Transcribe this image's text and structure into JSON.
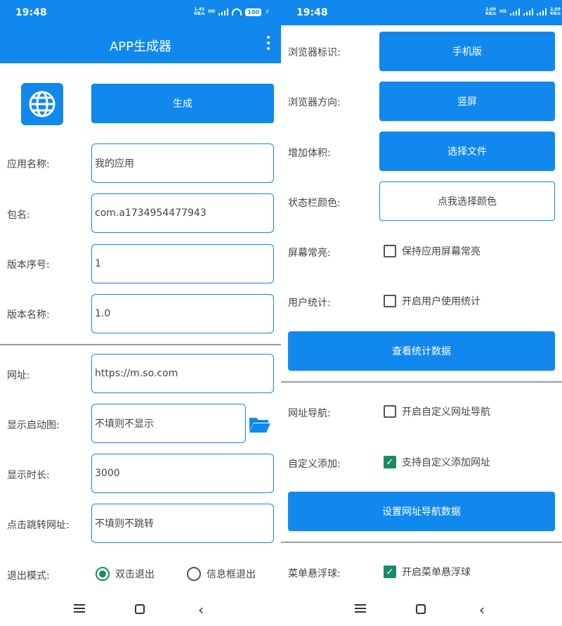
{
  "status": {
    "left_time": "19:48",
    "left_speed_value": "1.45",
    "left_speed_unit": "KB/s",
    "left_hd": "HD",
    "left_battery": "100",
    "right_time": "19:48",
    "right_speed_value": "2.09",
    "right_speed_unit": "KB/s",
    "right_hd": "HD",
    "right_speed2_value": "2.09",
    "right_speed2_unit": "KB/s"
  },
  "appbar": {
    "title": "APP生成器",
    "menu_icon": "more-vertical-icon"
  },
  "generate_button": "生成",
  "fields": {
    "app_name": {
      "label": "应用名称:",
      "value": "我的应用"
    },
    "package": {
      "label": "包名:",
      "value": "com.a1734954477943"
    },
    "version_code": {
      "label": "版本序号:",
      "value": "1"
    },
    "version_name": {
      "label": "版本名称:",
      "value": "1.0"
    },
    "url": {
      "label": "网址:",
      "value": "https://m.so.com"
    },
    "splash": {
      "label": "显示启动图:",
      "value": "不填则不显示"
    },
    "duration": {
      "label": "显示时长:",
      "value": "3000"
    },
    "click_url": {
      "label": "点击跳转网址:",
      "value": "不填则不跳转"
    }
  },
  "exit_mode": {
    "label": "退出模式:",
    "options": [
      {
        "label": "双击退出",
        "selected": true
      },
      {
        "label": "信息框退出",
        "selected": false
      }
    ]
  },
  "right": {
    "ua": {
      "label": "浏览器标识:",
      "value": "手机版"
    },
    "orientation": {
      "label": "浏览器方向:",
      "value": "竖屏"
    },
    "size": {
      "label": "增加体积:",
      "value": "选择文件"
    },
    "statusbar_color": {
      "label": "状态栏颜色:",
      "value": "点我选择颜色"
    },
    "keep_screen": {
      "label": "屏幕常亮:",
      "option": "保持应用屏幕常亮",
      "checked": false
    },
    "stats": {
      "label": "用户统计:",
      "option": "开启用户使用统计",
      "checked": false
    },
    "view_stats_button": "查看统计数据",
    "url_nav": {
      "label": "网址导航:",
      "option": "开启自定义网址导航",
      "checked": false
    },
    "custom_add": {
      "label": "自定义添加:",
      "option": "支持自定义添加网址",
      "checked": true
    },
    "set_nav_button": "设置网址导航数据",
    "float_menu": {
      "label": "菜单悬浮球:",
      "option": "开启菜单悬浮球",
      "checked": true
    }
  },
  "colors": {
    "accent": "#1188ee",
    "check": "#1b8a6b",
    "divider": "#9a9a9a"
  }
}
